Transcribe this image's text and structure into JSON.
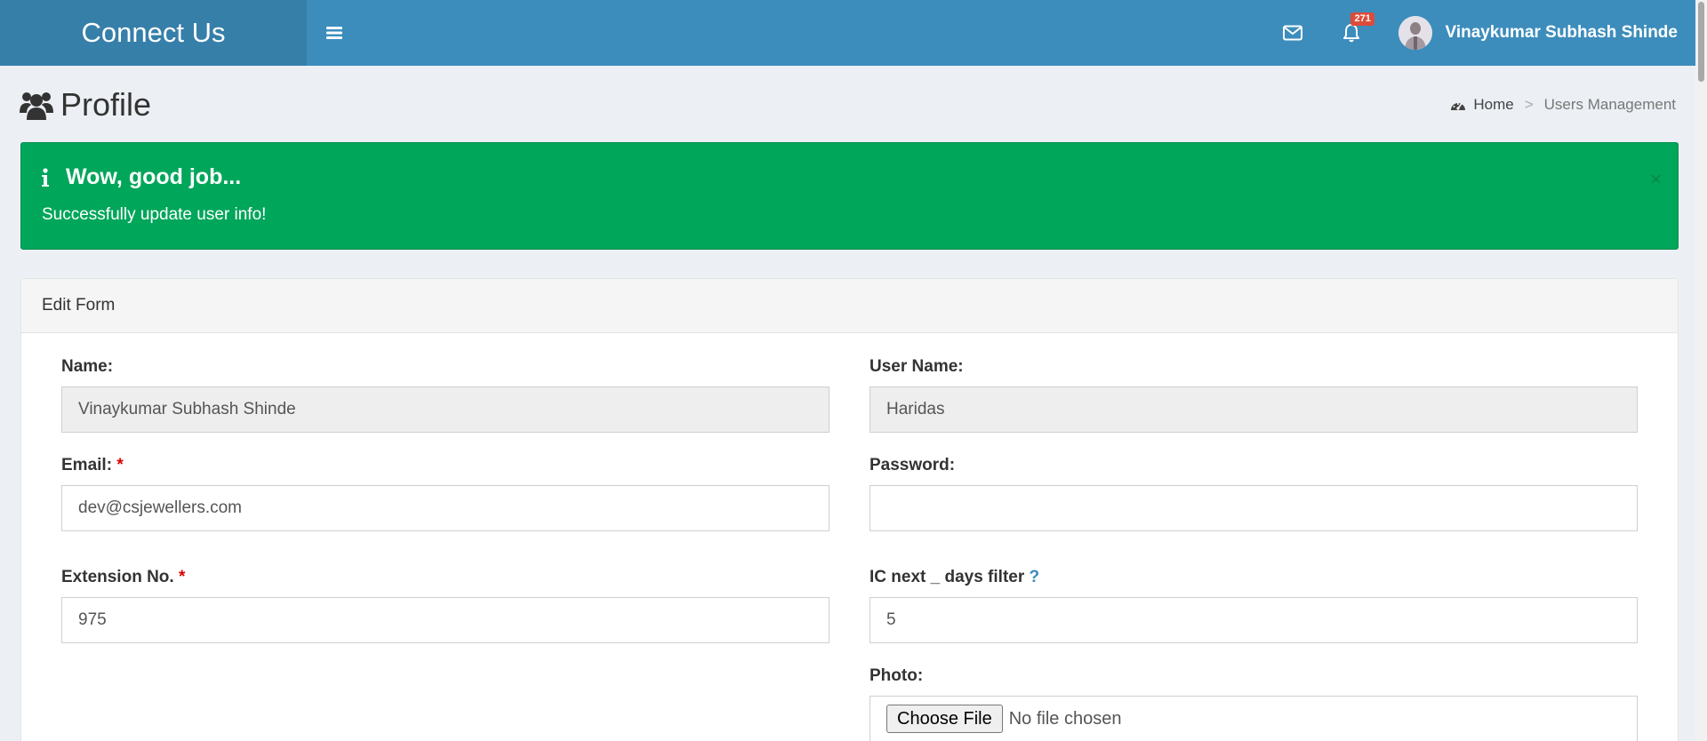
{
  "app": {
    "title": "Connect Us"
  },
  "header": {
    "notification_count": "271",
    "user_name": "Vinaykumar Subhash Shinde"
  },
  "page": {
    "title": "Profile"
  },
  "breadcrumb": {
    "home": "Home",
    "separator": ">",
    "current": "Users Management"
  },
  "alert": {
    "title": "Wow, good job...",
    "message": "Successfully update user info!",
    "close": "×"
  },
  "form": {
    "title": "Edit Form",
    "name_label": "Name:",
    "name_value": "Vinaykumar Subhash Shinde",
    "username_label": "User Name:",
    "username_value": "Haridas",
    "email_label": "Email:",
    "email_required": "*",
    "email_value": "dev@csjewellers.com",
    "password_label": "Password:",
    "password_value": "",
    "extension_label": "Extension No.",
    "extension_required": "*",
    "extension_value": "975",
    "ic_filter_label": "IC next _ days filter",
    "ic_filter_help": "?",
    "ic_filter_value": "5",
    "photo_label": "Photo:",
    "photo_button": "Choose File",
    "photo_status": "No file chosen"
  },
  "colors": {
    "header": "#3c8dbc",
    "logo_bg": "#367fa9",
    "alert_success": "#00a65a",
    "badge": "#dd4b39",
    "required": "#dd0000"
  },
  "icons": {
    "menu": "hamburger-icon",
    "mail": "envelope-icon",
    "notifications": "bell-icon",
    "page": "users-icon",
    "breadcrumb_home": "dashboard-icon",
    "alert": "info-icon"
  }
}
